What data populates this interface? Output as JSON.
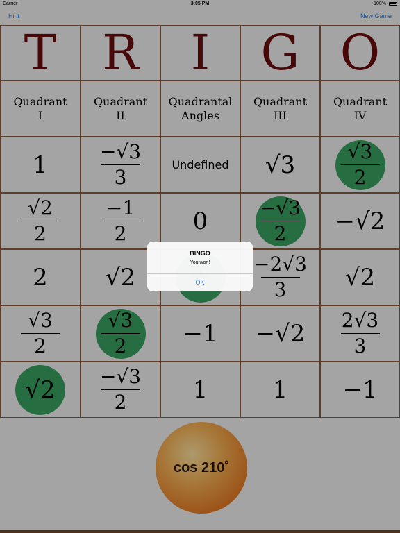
{
  "status_bar": {
    "carrier": "Carrier",
    "time": "3:05 PM",
    "battery": "100%"
  },
  "nav": {
    "hint": "Hint",
    "new_game": "New Game"
  },
  "title_letters": [
    "T",
    "R",
    "I",
    "G",
    "O"
  ],
  "headers": [
    {
      "line1": "Quadrant",
      "line2": "I"
    },
    {
      "line1": "Quadrant",
      "line2": "II"
    },
    {
      "line1": "Quadrantal",
      "line2": "Angles"
    },
    {
      "line1": "Quadrant",
      "line2": "III"
    },
    {
      "line1": "Quadrant",
      "line2": "IV"
    }
  ],
  "grid": [
    [
      {
        "text": "1"
      },
      {
        "num": "−√3",
        "den": "3"
      },
      {
        "text": "Undefined",
        "small": true
      },
      {
        "text": "√3"
      },
      {
        "num": "√3",
        "den": "2",
        "marked": true
      }
    ],
    [
      {
        "num": "√2",
        "den": "2"
      },
      {
        "num": "−1",
        "den": "2"
      },
      {
        "text": "0"
      },
      {
        "num": "−√3",
        "den": "2",
        "marked": true
      },
      {
        "text": "−√2"
      }
    ],
    [
      {
        "text": "2"
      },
      {
        "text": "√2"
      },
      {
        "text": "★",
        "marked": true
      },
      {
        "num": "−2√3",
        "den": "3"
      },
      {
        "text": "√2"
      }
    ],
    [
      {
        "num": "√3",
        "den": "2"
      },
      {
        "num": "√3",
        "den": "2",
        "marked": true
      },
      {
        "text": "−1"
      },
      {
        "text": "−√2"
      },
      {
        "num": "2√3",
        "den": "3"
      }
    ],
    [
      {
        "text": "√2",
        "marked": true
      },
      {
        "num": "−√3",
        "den": "2"
      },
      {
        "text": "1"
      },
      {
        "text": "1"
      },
      {
        "text": "−1"
      }
    ]
  ],
  "ball": {
    "label": "cos 210˚"
  },
  "alert": {
    "title": "BINGO",
    "message": "You won!",
    "ok_label": "OK"
  },
  "colors": {
    "marker": "#2e9e5a",
    "title_letter": "#6b0d0d",
    "link": "#2a7de1",
    "border": "#8b5a3c"
  }
}
